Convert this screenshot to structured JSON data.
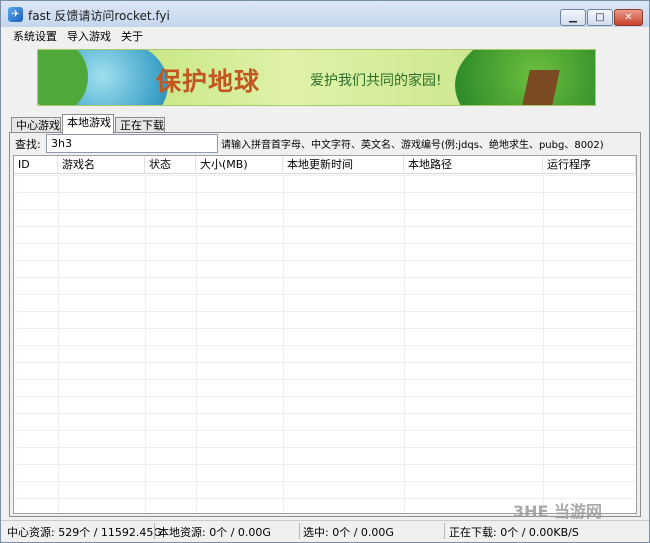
{
  "window": {
    "title": "fast 反馈请访问rocket.fyi",
    "minimize_glyph": "▁",
    "maximize_glyph": "□",
    "close_glyph": "✕"
  },
  "menu": [
    "系统设置",
    "导入游戏",
    "关于"
  ],
  "banner": {
    "title": "保护地球",
    "subtitle": "爱护我们共同的家园!"
  },
  "tabs": [
    "中心游戏",
    "本地游戏",
    "正在下载"
  ],
  "active_tab": "本地游戏",
  "search": {
    "label": "查找:",
    "value": "3h3",
    "hint": "请输入拼音首字母、中文字符、英文名、游戏编号(例:jdqs、绝地求生、pubg、8002)"
  },
  "table": {
    "columns": [
      "ID",
      "游戏名",
      "状态",
      "大小(MB)",
      "本地更新时间",
      "本地路径",
      "运行程序"
    ],
    "rows": []
  },
  "status": {
    "center": "中心资源: 529个 / 11592.45G",
    "local": "本地资源: 0个 / 0.00G",
    "selected": "选中: 0个 / 0.00G",
    "downloading": "正在下载: 0个 / 0.00KB/S"
  },
  "watermark": "3HE 当游网",
  "icons": {
    "app": "rocket-app-icon"
  }
}
